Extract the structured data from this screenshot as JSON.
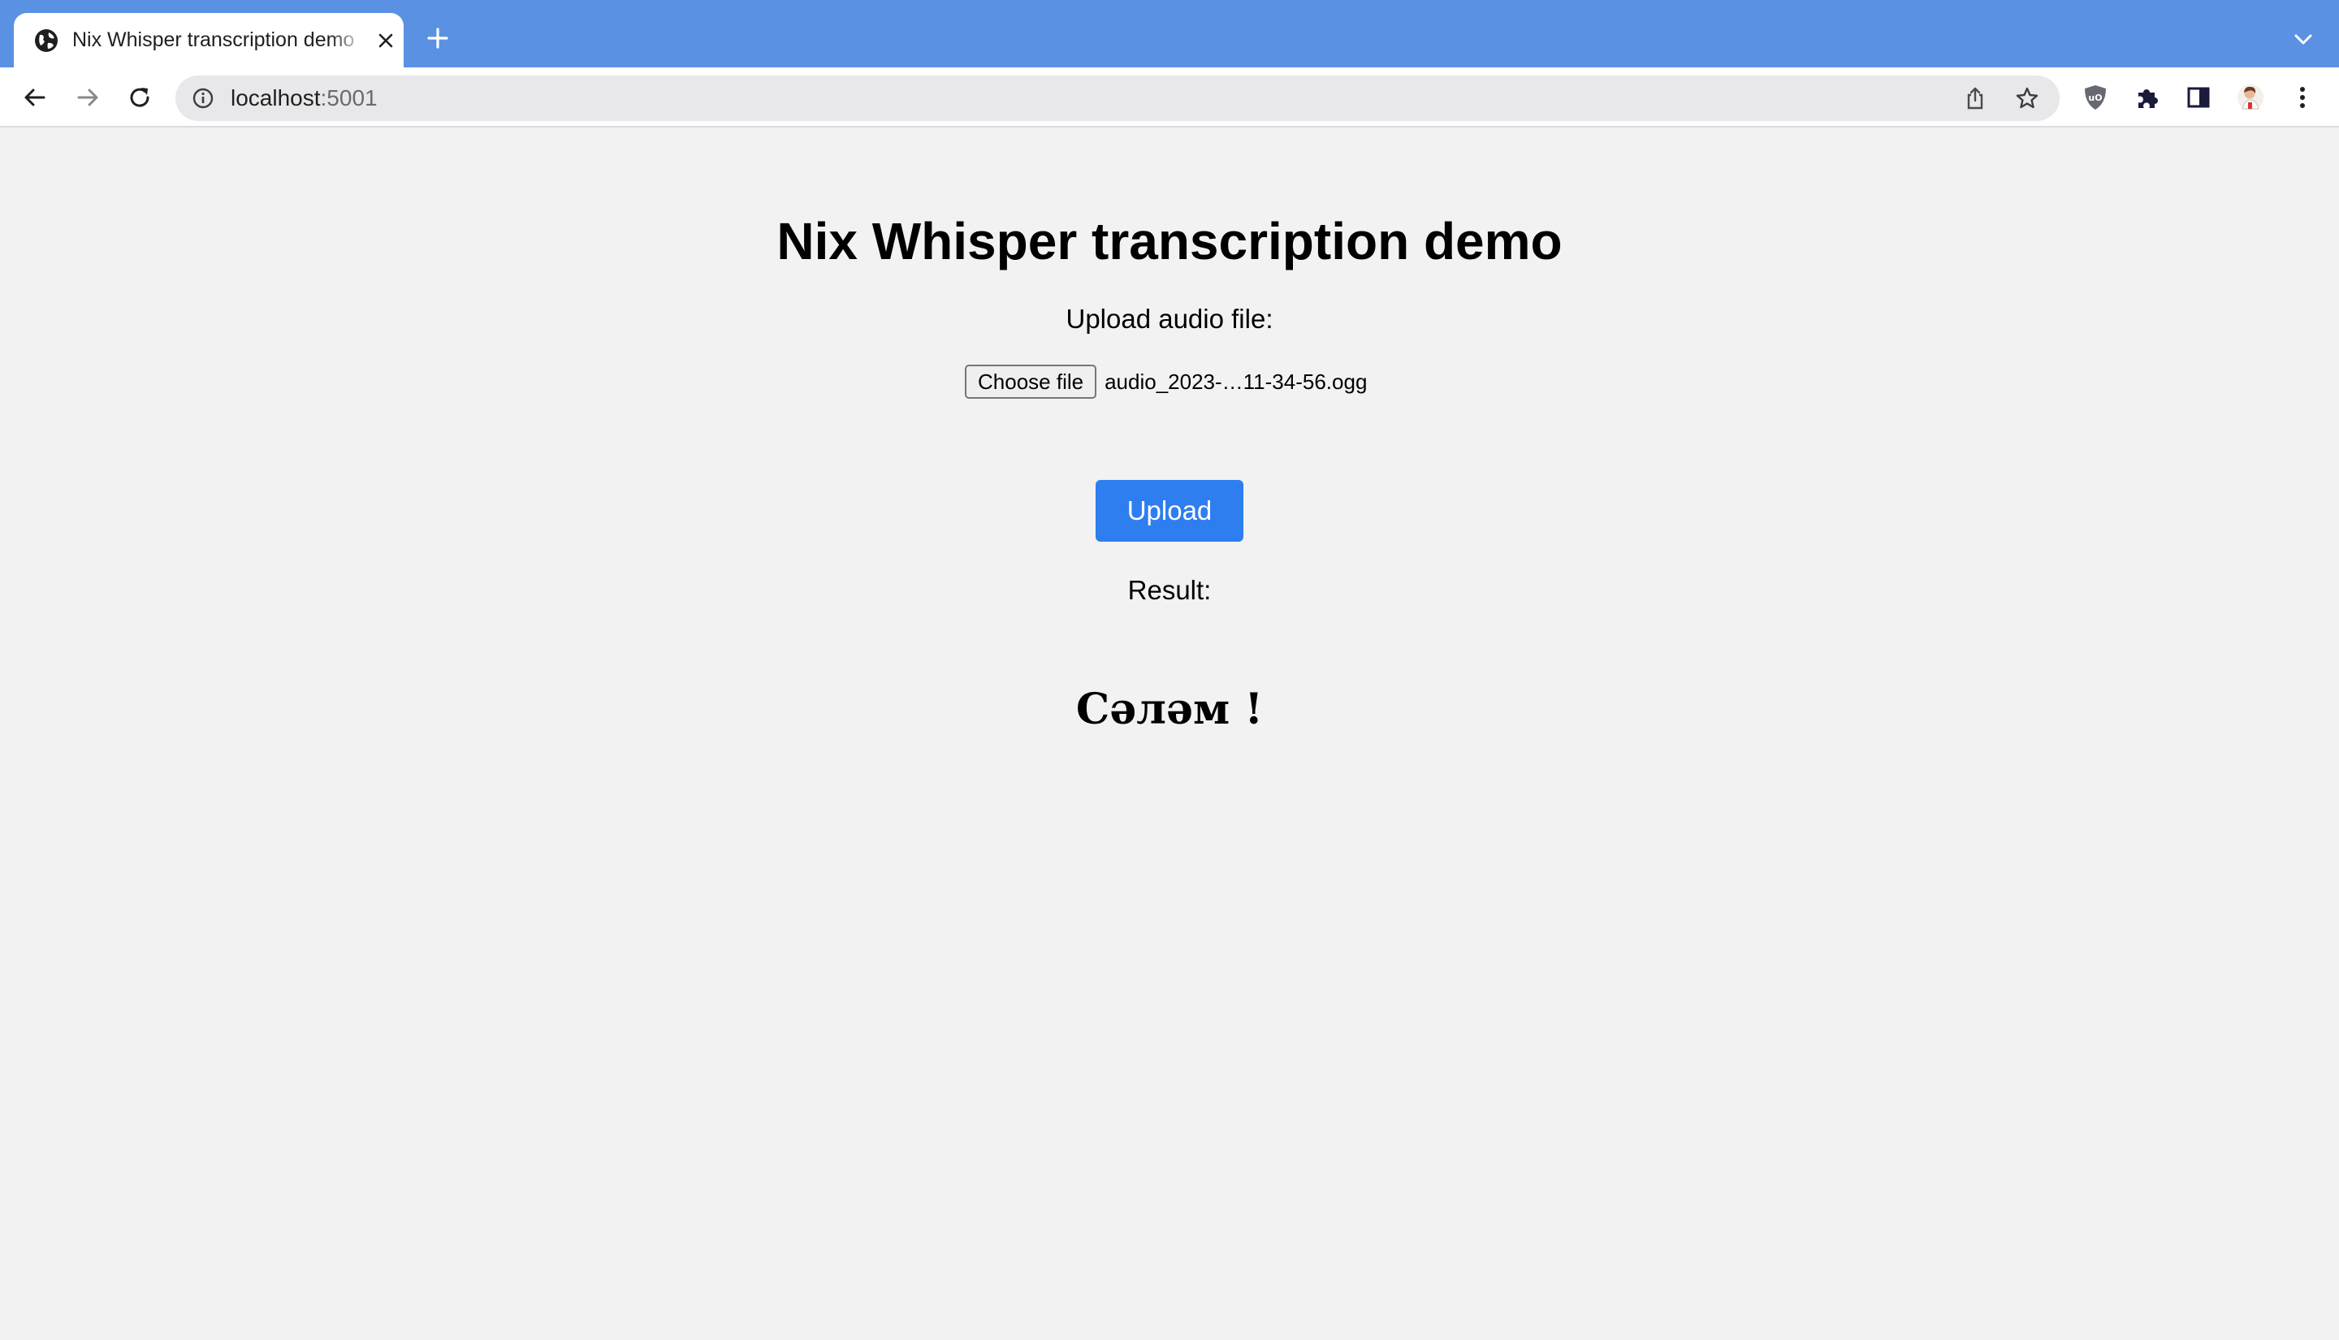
{
  "browser": {
    "tab": {
      "title": "Nix Whisper transcription demo",
      "favicon": "globe-icon",
      "close_icon": "close-icon"
    },
    "new_tab_icon": "plus-icon",
    "tab_search_icon": "chevron-down-icon",
    "address_bar": {
      "host": "localhost",
      "port": ":5001",
      "site_info_icon": "info-icon",
      "share_icon": "share-icon",
      "bookmark_icon": "star-icon"
    },
    "nav_icons": [
      "back-arrow-icon",
      "forward-arrow-icon",
      "reload-icon"
    ],
    "extension_icons": [
      "ublock-shield-icon",
      "puzzle-extensions-icon",
      "side-panel-icon",
      "profile-avatar-icon",
      "kebab-menu-icon"
    ],
    "colors": {
      "tabstrip": "#5b91e2",
      "toolbar": "#ffffff",
      "omnibox": "#e8e8ea"
    }
  },
  "page": {
    "title": "Nix Whisper transcription demo",
    "upload_label": "Upload audio file:",
    "file_input": {
      "button_label": "Choose file",
      "selected_file": "audio_2023-…11-34-56.ogg"
    },
    "upload_button": "Upload",
    "result_label": "Result:",
    "result_text": "Сәләм !",
    "colors": {
      "background": "#f2f2f2",
      "upload_button": "#2e7ef0"
    }
  }
}
